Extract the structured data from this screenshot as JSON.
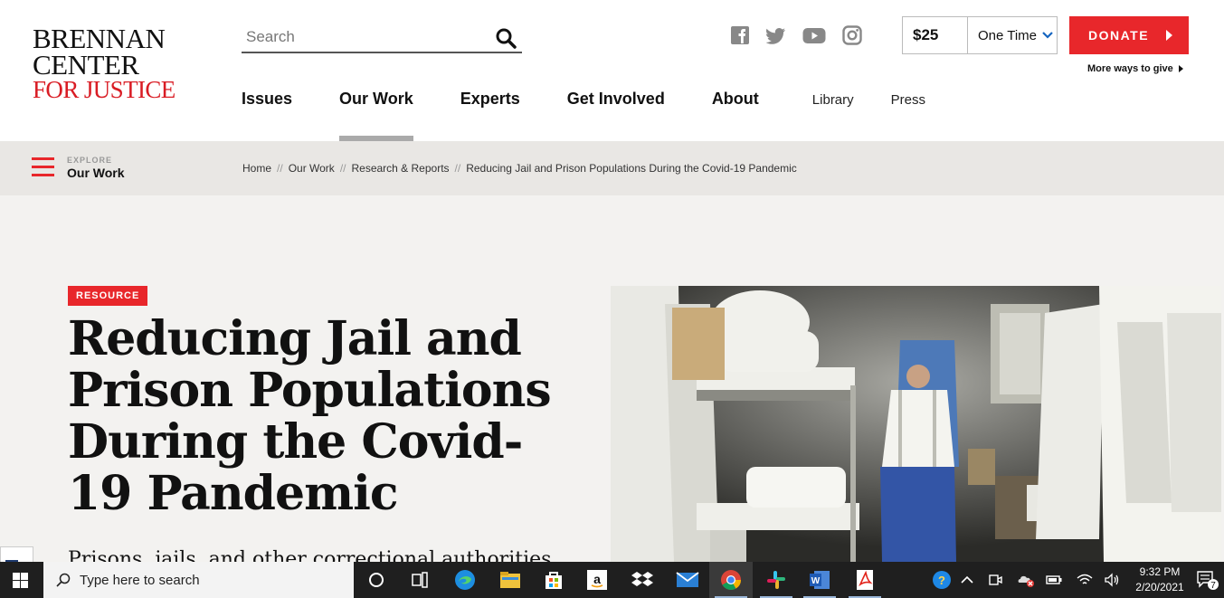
{
  "logo": {
    "line1": "BRENNAN",
    "line2": "CENTER",
    "line3": "FOR JUSTICE"
  },
  "search": {
    "placeholder": "Search"
  },
  "social": [
    "facebook-icon",
    "twitter-icon",
    "youtube-icon",
    "instagram-icon"
  ],
  "donate": {
    "amount": "$25",
    "frequency": "One Time",
    "button": "DONATE",
    "more_ways": "More ways to give"
  },
  "nav": {
    "items": [
      "Issues",
      "Our Work",
      "Experts",
      "Get Involved",
      "About"
    ],
    "active": "Our Work",
    "secondary": [
      "Library",
      "Press"
    ]
  },
  "explore": {
    "label_small": "EXPLORE",
    "label": "Our Work"
  },
  "breadcrumb": [
    "Home",
    "Our Work",
    "Research & Reports",
    "Reducing Jail and Prison Populations During the Covid-19 Pandemic"
  ],
  "breadcrumb_sep": "//",
  "hero": {
    "badge": "RESOURCE",
    "title": "Reducing Jail and Prison Populations During the Covid-19 Pandemic",
    "intro": "Prisons, jails, and other correctional authorities"
  },
  "taskbar": {
    "search_placeholder": "Type here to search",
    "time": "9:32 PM",
    "date": "2/20/2021",
    "notifications": "7"
  },
  "colors": {
    "brand_red": "#e8272b",
    "explore_bg": "#e9e7e4",
    "hero_bg": "#f3f2f0"
  }
}
